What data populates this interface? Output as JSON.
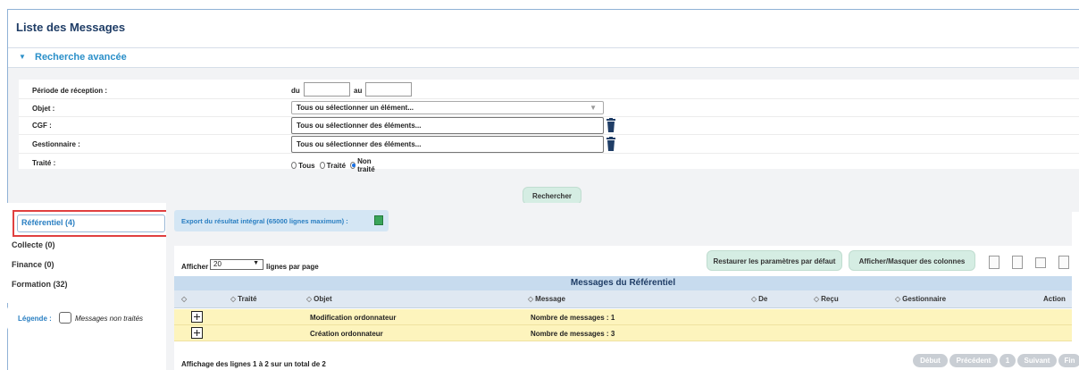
{
  "page_title": "Liste des Messages",
  "search": {
    "section_title": "Recherche avancée",
    "fields": {
      "periode_label": "Période de réception :",
      "du": "du",
      "au": "au",
      "objet_label": "Objet :",
      "objet_placeholder": "Tous ou sélectionner un élément...",
      "cgf_label": "CGF :",
      "cgf_placeholder": "Tous ou sélectionner des éléments...",
      "gestionnaire_label": "Gestionnaire :",
      "gestionnaire_placeholder": "Tous ou sélectionner des éléments...",
      "traite_label": "Traité :",
      "traite_options": [
        "Tous",
        "Traité",
        "Non traité"
      ],
      "traite_selected": "Non traité"
    },
    "search_button": "Rechercher"
  },
  "nav": {
    "items": [
      {
        "label": "Référentiel (4)",
        "active": true
      },
      {
        "label": "Collecte (0)"
      },
      {
        "label": "Finance (0)"
      },
      {
        "label": "Formation (32)"
      }
    ]
  },
  "legend": {
    "title": "Légende :",
    "item": "Messages non traités"
  },
  "export": {
    "label": "Export du résultat intégral (65000 lignes maximum) :"
  },
  "table": {
    "show_label": "Afficher",
    "per_page_value": "20",
    "per_page_suffix": "lignes par page",
    "restore_button": "Restaurer les paramètres par défaut",
    "columns_button": "Afficher/Masquer des colonnes",
    "caption": "Messages du Référentiel",
    "headers": [
      "",
      "Traité",
      "Objet",
      "Message",
      "De",
      "Reçu",
      "Gestionnaire",
      "Action"
    ],
    "rows": [
      {
        "objet": "Modification ordonnateur",
        "message": "Nombre de messages : 1"
      },
      {
        "objet": "Création ordonnateur",
        "message": "Nombre de messages : 3"
      }
    ],
    "info": "Affichage des lignes 1 à 2 sur un total de 2",
    "pagination": [
      "Début",
      "Précédent",
      "1",
      "Suivant",
      "Fin"
    ]
  },
  "colors": {
    "title": "#1f3d66",
    "accent": "#2a8fc9",
    "row_highlight": "#fdf4bd",
    "caption_bg": "#c7dbee",
    "button_bg": "#d5ede3",
    "red_highlight": "#e04040"
  },
  "icons": [
    "expand-arrow-icon",
    "trash-icon",
    "excel-icon",
    "csv-icon",
    "pdf-icon",
    "print-icon",
    "export-icon",
    "expand-row-icon"
  ]
}
